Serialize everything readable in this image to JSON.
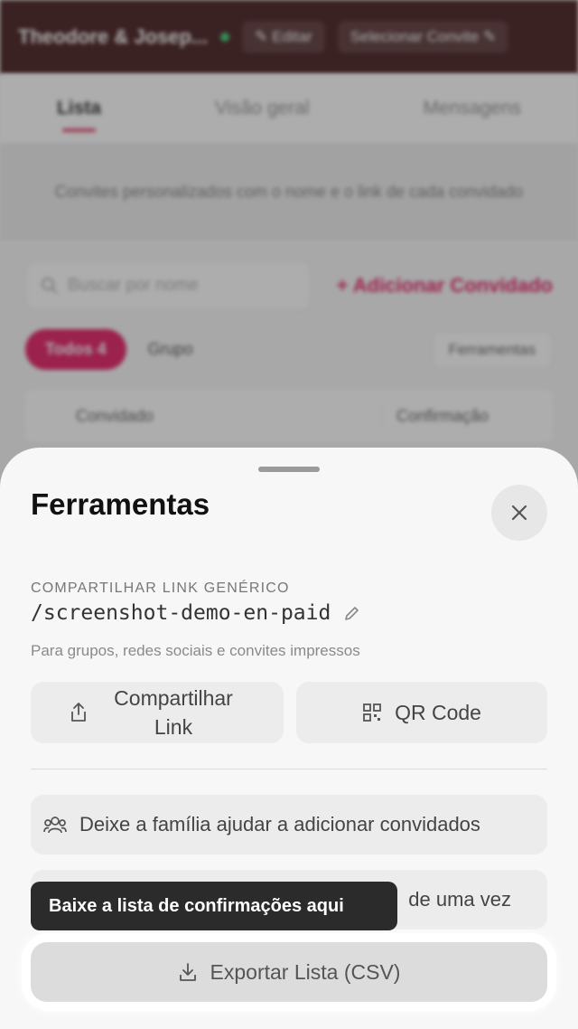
{
  "header": {
    "couple_name": "Theodore & Josep...",
    "edit_label": "✎ Editar",
    "select_label": "Selecionar Convite ✎"
  },
  "tabs": [
    {
      "label": "Lista",
      "active": true
    },
    {
      "label": "Visão geral",
      "active": false
    },
    {
      "label": "Mensagens",
      "active": false
    }
  ],
  "banner_text": "Convites personalizados com o nome e o link de cada convidado",
  "search_placeholder": "Buscar por nome",
  "add_guest_label": "Adicionar Convidado",
  "filter_all_label": "Todos 4",
  "group_label": "Grupo",
  "tools_label": "Ferramentas",
  "table_headers": [
    "Convidado",
    "Confirmação"
  ],
  "sheet": {
    "title": "Ferramentas",
    "section_label": "COMPARTILHAR LINK GENÉRICO",
    "link_text": "/screenshot-demo-en-paid",
    "hint": "Para grupos, redes sociais e convites impressos",
    "share_label": "Compartilhar Link",
    "qr_label": "QR Code",
    "family_label": "Deixe a família ajudar a adicionar convidados",
    "bulk_label": "de uma vez",
    "export_label": "Exportar Lista (CSV)",
    "tooltip": "Baixe a lista de confirmações aqui"
  },
  "colors": {
    "accent": "#e1105b",
    "header_bg": "#3a0e10",
    "tooltip_bg": "#2b2b2b"
  }
}
